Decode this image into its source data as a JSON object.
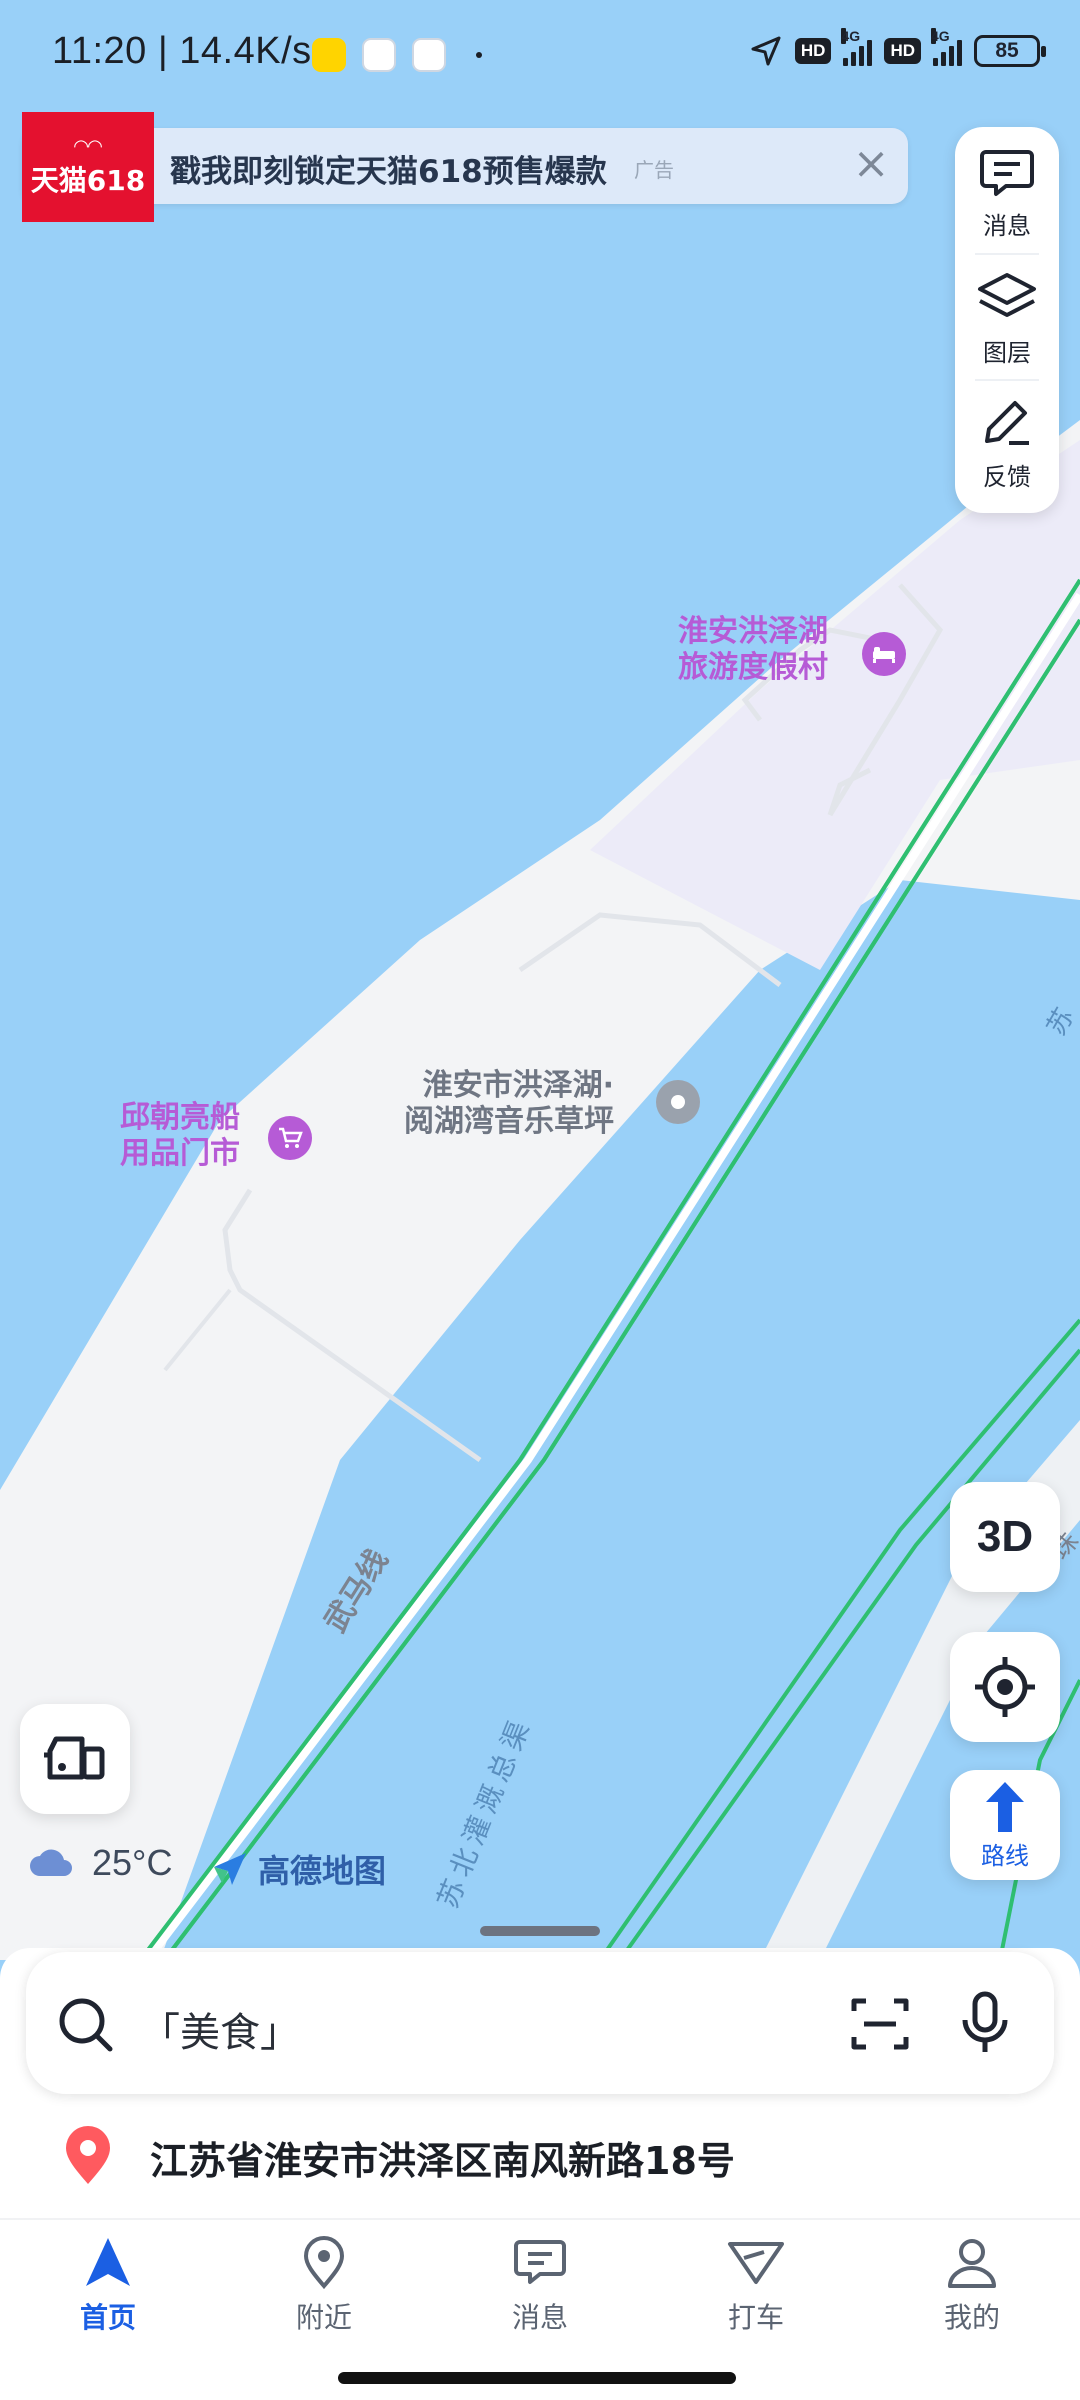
{
  "status_bar": {
    "time": "11:20",
    "speed": "14.4K/s",
    "hd1": "HD",
    "net1": "4G",
    "hd2": "HD",
    "net2": "4G",
    "battery": "85"
  },
  "ad": {
    "logo_text": "天猫618",
    "text": "戳我即刻锁定天猫618预售爆款",
    "tag": "广告",
    "close_icon": "close-icon"
  },
  "toolbar": {
    "messages": "消息",
    "layers": "图层",
    "feedback": "反馈"
  },
  "map": {
    "poi_resort_line1": "淮安洪泽湖",
    "poi_resort_line2": "旅游度假村",
    "poi_lawn_line1": "淮安市洪泽湖·",
    "poi_lawn_line2": "阅湖湾音乐草坪",
    "poi_shop_line1": "邱朝亮船",
    "poi_shop_line2": "用品门市",
    "road_label": "武马线",
    "canal_label": "苏北灌溉总渠",
    "edge_label_1": "苏",
    "edge_label_2": "珠",
    "colors": {
      "water": "#99d0f8",
      "land": "#f3f4f6",
      "resort": "#ecebf8",
      "road": "#2fbf71",
      "poi_purple": "#b65bd6"
    }
  },
  "controls": {
    "three_d": "3D",
    "route": "路线"
  },
  "weather": {
    "temp": "25°C",
    "brand": "高德地图"
  },
  "search": {
    "placeholder": "「美食」"
  },
  "location": {
    "address": "江苏省淮安市洪泽区南风新路18号"
  },
  "tabs": [
    {
      "label": "首页",
      "active": true
    },
    {
      "label": "附近",
      "active": false
    },
    {
      "label": "消息",
      "active": false
    },
    {
      "label": "打车",
      "active": false
    },
    {
      "label": "我的",
      "active": false
    }
  ]
}
